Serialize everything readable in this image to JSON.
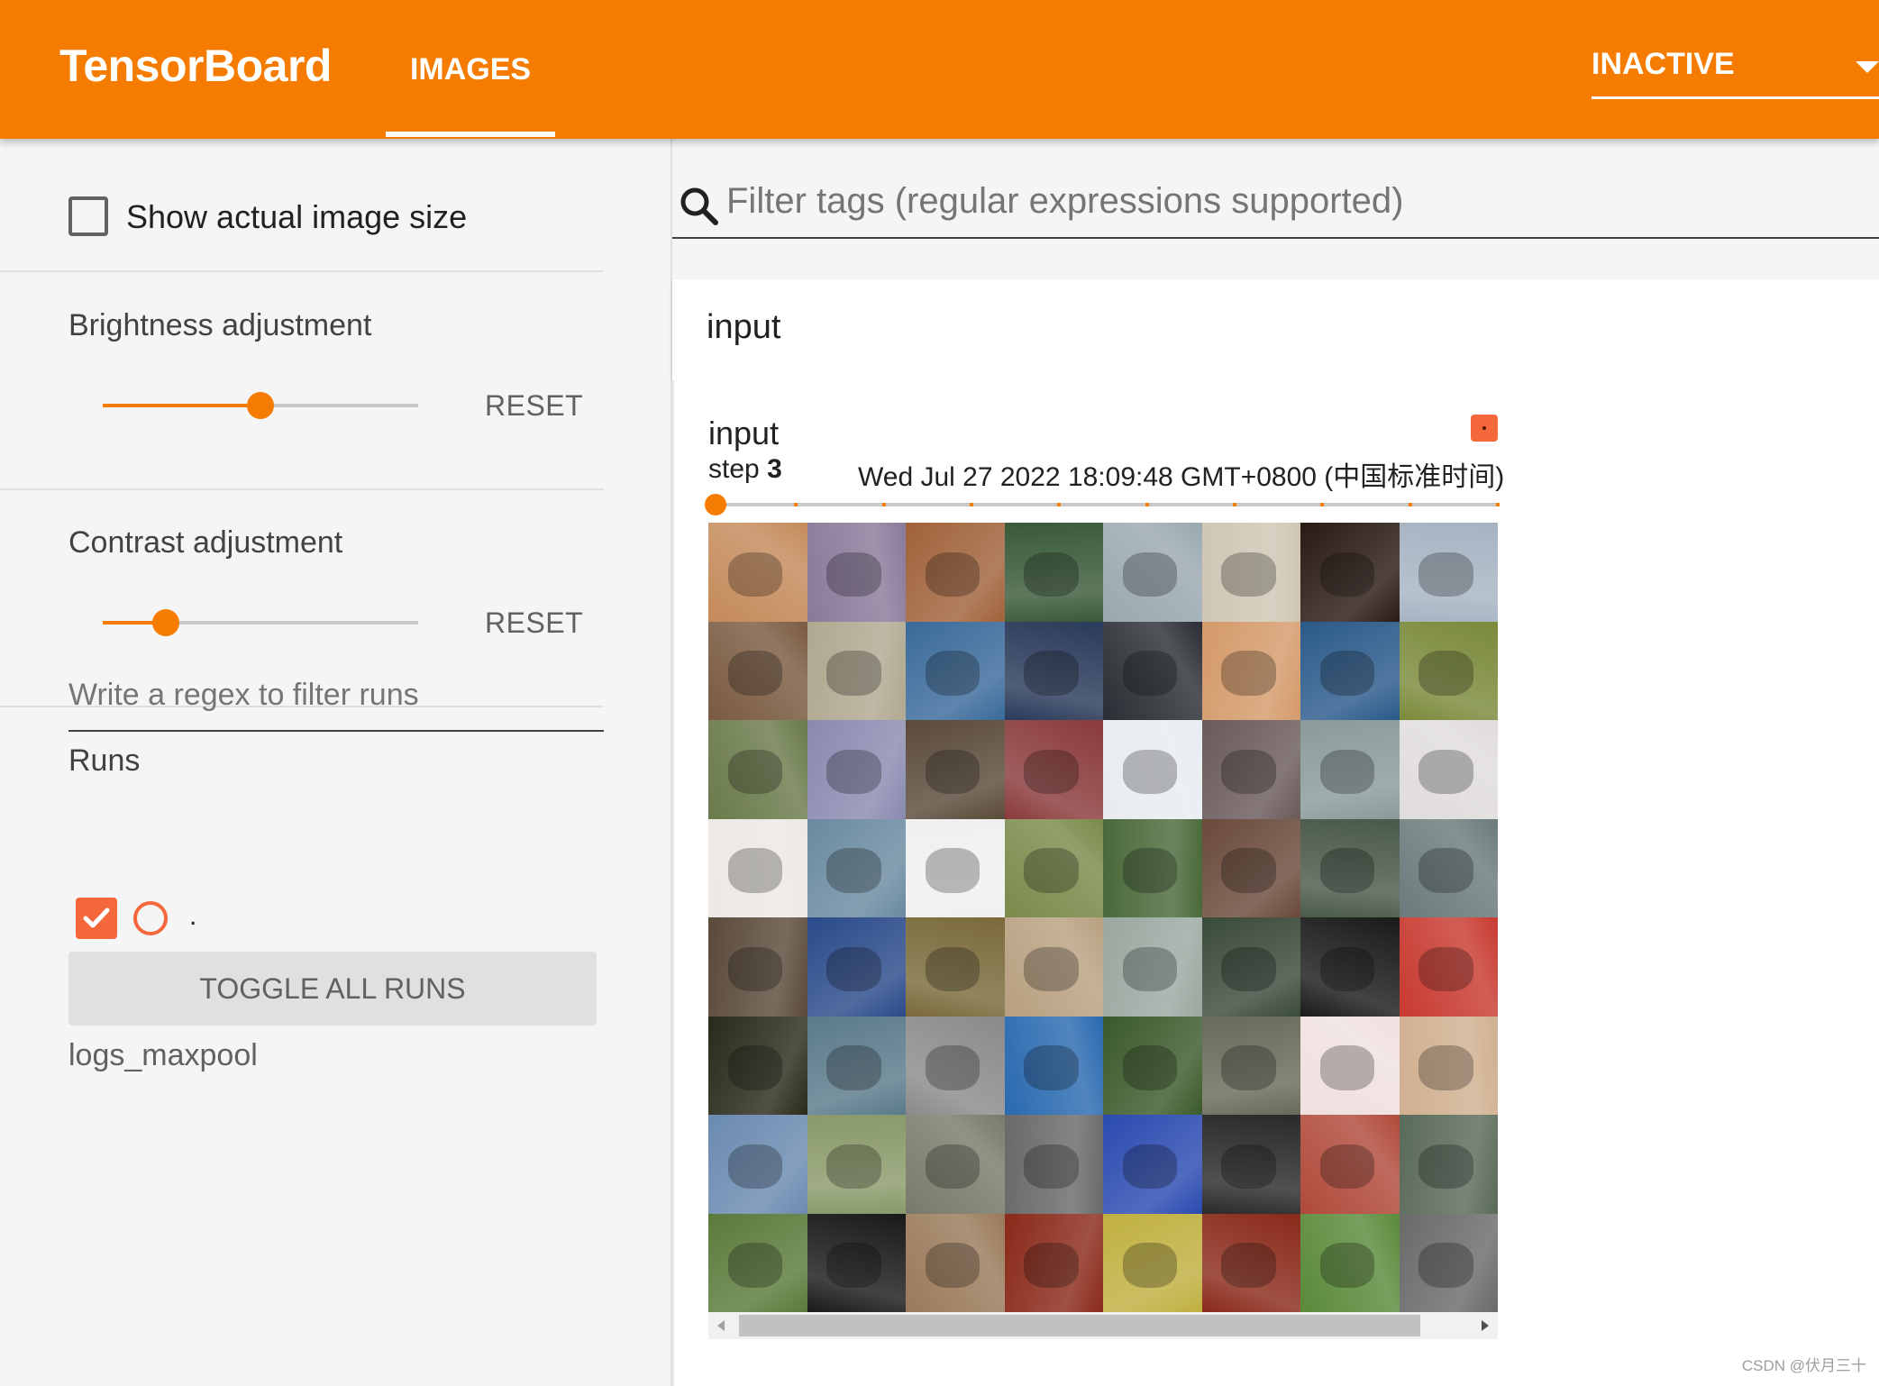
{
  "header": {
    "brand": "TensorBoard",
    "tab_label": "IMAGES",
    "run_select_label": "INACTIVE",
    "brand_color": "#f57c00"
  },
  "sidebar": {
    "show_actual_size_label": "Show actual image size",
    "show_actual_size_checked": false,
    "brightness": {
      "title": "Brightness adjustment",
      "reset_label": "RESET",
      "value": 0.5
    },
    "contrast": {
      "title": "Contrast adjustment",
      "reset_label": "RESET",
      "value": 0.2
    },
    "runs": {
      "title": "Runs",
      "filter_placeholder": "Write a regex to filter runs",
      "run_items": [
        {
          "label": ".",
          "checked": true,
          "color": "#f4683b"
        }
      ],
      "toggle_all_label": "TOGGLE ALL RUNS",
      "run_name": "logs_maxpool"
    }
  },
  "main": {
    "search_placeholder": "Filter tags (regular expressions supported)",
    "card_title": "input",
    "image_card": {
      "tag": "input",
      "step_label": "step",
      "step_value": "3",
      "timestamp": "Wed Jul 27 2022 18:09:48 GMT+0800 (中国标准时间)",
      "step_position": 0,
      "step_ticks": 10
    },
    "image_grid": {
      "rows": 8,
      "cols": 8,
      "tile_colors": [
        "#c48a5a",
        "#8a7a9a",
        "#a0623a",
        "#3a5a3a",
        "#9aa8b0",
        "#cfc6b4",
        "#2a1a14",
        "#a6b4c2",
        "#7a5a40",
        "#b0a890",
        "#3a6a9a",
        "#2a3a5a",
        "#2a2e34",
        "#d49a6a",
        "#2a5a8a",
        "#7a8a3a",
        "#6a7a4a",
        "#8a8ab0",
        "#5a4a3a",
        "#8a3a3a",
        "#e8ecf0",
        "#6a5a5a",
        "#8a9a9a",
        "#e0dcdc",
        "#ece8e4",
        "#6a8aa0",
        "#f0f0f0",
        "#7a8a4a",
        "#4a6a3a",
        "#6a4a3a",
        "#4a5a4a",
        "#6a7a7a",
        "#5a4a3a",
        "#2a4a8a",
        "#7a6a3a",
        "#b8a080",
        "#9aa8a0",
        "#3a4a3a",
        "#1a1a1a",
        "#c83a30",
        "#2a2a1a",
        "#5a7a8a",
        "#8a8a8a",
        "#2a6ab0",
        "#3a5a2a",
        "#6a6a5a",
        "#f0e0e0",
        "#d0b090",
        "#6a8ab0",
        "#8a9a6a",
        "#7a7a6a",
        "#6a6a6a",
        "#2a4ab0",
        "#2a2a2a",
        "#b04a3a",
        "#5a6a5a",
        "#5a7a3a",
        "#1a1a1a",
        "#9a7a5a",
        "#8a2a1a",
        "#c0b040",
        "#8a2a1a",
        "#5a8a3a",
        "#6a6a6a"
      ]
    },
    "watermark": "CSDN @伏月三十"
  }
}
